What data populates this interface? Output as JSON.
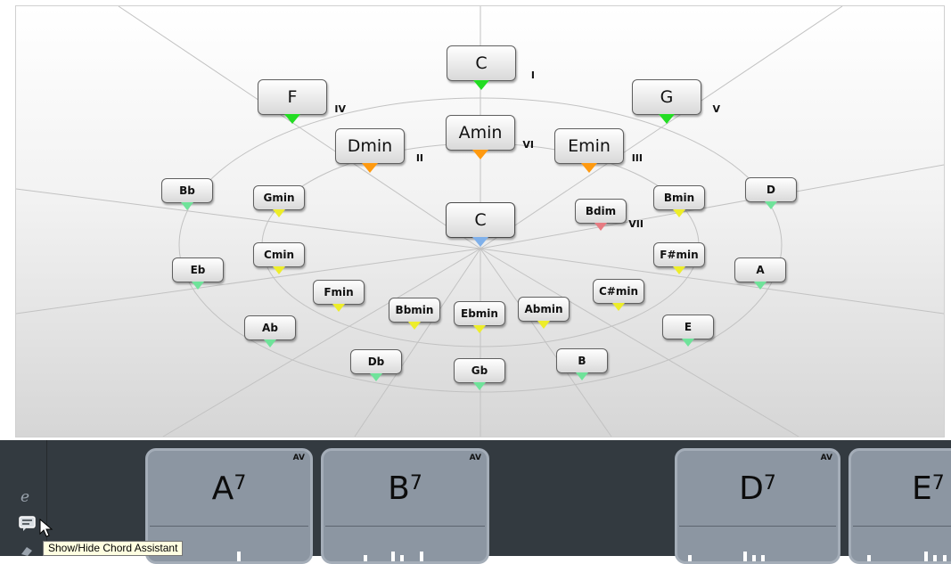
{
  "circle": {
    "major_outer": [
      {
        "id": "C",
        "label": "C",
        "degree": "I",
        "size": "big",
        "marker": "#22dd22"
      },
      {
        "id": "F",
        "label": "F",
        "degree": "IV",
        "size": "big",
        "marker": "#22dd22"
      },
      {
        "id": "G",
        "label": "G",
        "degree": "V",
        "size": "big",
        "marker": "#22dd22"
      },
      {
        "id": "Bb",
        "label": "Bb",
        "degree": "",
        "size": "small",
        "marker": "#6fe39a"
      },
      {
        "id": "D",
        "label": "D",
        "degree": "",
        "size": "small",
        "marker": "#6fe39a"
      },
      {
        "id": "Eb",
        "label": "Eb",
        "degree": "",
        "size": "small",
        "marker": "#6fe39a"
      },
      {
        "id": "A",
        "label": "A",
        "degree": "",
        "size": "small",
        "marker": "#6fe39a"
      },
      {
        "id": "Ab",
        "label": "Ab",
        "degree": "",
        "size": "small",
        "marker": "#6fe39a"
      },
      {
        "id": "E",
        "label": "E",
        "degree": "",
        "size": "small",
        "marker": "#6fe39a"
      },
      {
        "id": "Db",
        "label": "Db",
        "degree": "",
        "size": "small",
        "marker": "#6fe39a"
      },
      {
        "id": "B",
        "label": "B",
        "degree": "",
        "size": "small",
        "marker": "#6fe39a"
      },
      {
        "id": "Gb",
        "label": "Gb",
        "degree": "",
        "size": "small",
        "marker": "#6fe39a"
      }
    ],
    "minor_inner": [
      {
        "id": "Amin",
        "label": "Amin",
        "degree": "VI",
        "size": "big",
        "marker": "#ff9a10"
      },
      {
        "id": "Dmin",
        "label": "Dmin",
        "degree": "II",
        "size": "big",
        "marker": "#ff9a10"
      },
      {
        "id": "Emin",
        "label": "Emin",
        "degree": "III",
        "size": "big",
        "marker": "#ff9a10"
      },
      {
        "id": "Gmin",
        "label": "Gmin",
        "degree": "",
        "size": "small",
        "marker": "#eded2a"
      },
      {
        "id": "Bmin",
        "label": "Bmin",
        "degree": "",
        "size": "small",
        "marker": "#eded2a"
      },
      {
        "id": "Cmin",
        "label": "Cmin",
        "degree": "",
        "size": "small",
        "marker": "#eded2a"
      },
      {
        "id": "Fsharpmin",
        "label": "F#min",
        "degree": "",
        "size": "small",
        "marker": "#eded2a"
      },
      {
        "id": "Fmin",
        "label": "Fmin",
        "degree": "",
        "size": "small",
        "marker": "#eded2a"
      },
      {
        "id": "Csharpmin",
        "label": "C#min",
        "degree": "",
        "size": "small",
        "marker": "#eded2a"
      },
      {
        "id": "Bbmin",
        "label": "Bbmin",
        "degree": "",
        "size": "small",
        "marker": "#eded2a"
      },
      {
        "id": "Abmin",
        "label": "Abmin",
        "degree": "",
        "size": "small",
        "marker": "#eded2a"
      },
      {
        "id": "Ebmin",
        "label": "Ebmin",
        "degree": "",
        "size": "small",
        "marker": "#eded2a"
      }
    ],
    "center": [
      {
        "id": "Ccenter",
        "label": "C",
        "degree": "",
        "size": "big",
        "marker": "#7fb0ea"
      },
      {
        "id": "Bdim",
        "label": "Bdim",
        "degree": "VII",
        "size": "small",
        "marker": "#e77b82"
      }
    ]
  },
  "pads": [
    {
      "id": "A7",
      "root": "A",
      "ext": "7",
      "badge": "AV"
    },
    {
      "id": "B7",
      "root": "B",
      "ext": "7",
      "badge": "AV"
    },
    {
      "id": "D7",
      "root": "D",
      "ext": "7",
      "badge": "AV"
    },
    {
      "id": "E7",
      "root": "E",
      "ext": "7",
      "badge": ""
    }
  ],
  "sidebar": {
    "edit_icon": "e-letter-icon",
    "assistant_icon": "speech-bubble-icon",
    "third_icon": "eraser-icon"
  },
  "tooltip": {
    "text": "Show/Hide Chord Assistant"
  }
}
